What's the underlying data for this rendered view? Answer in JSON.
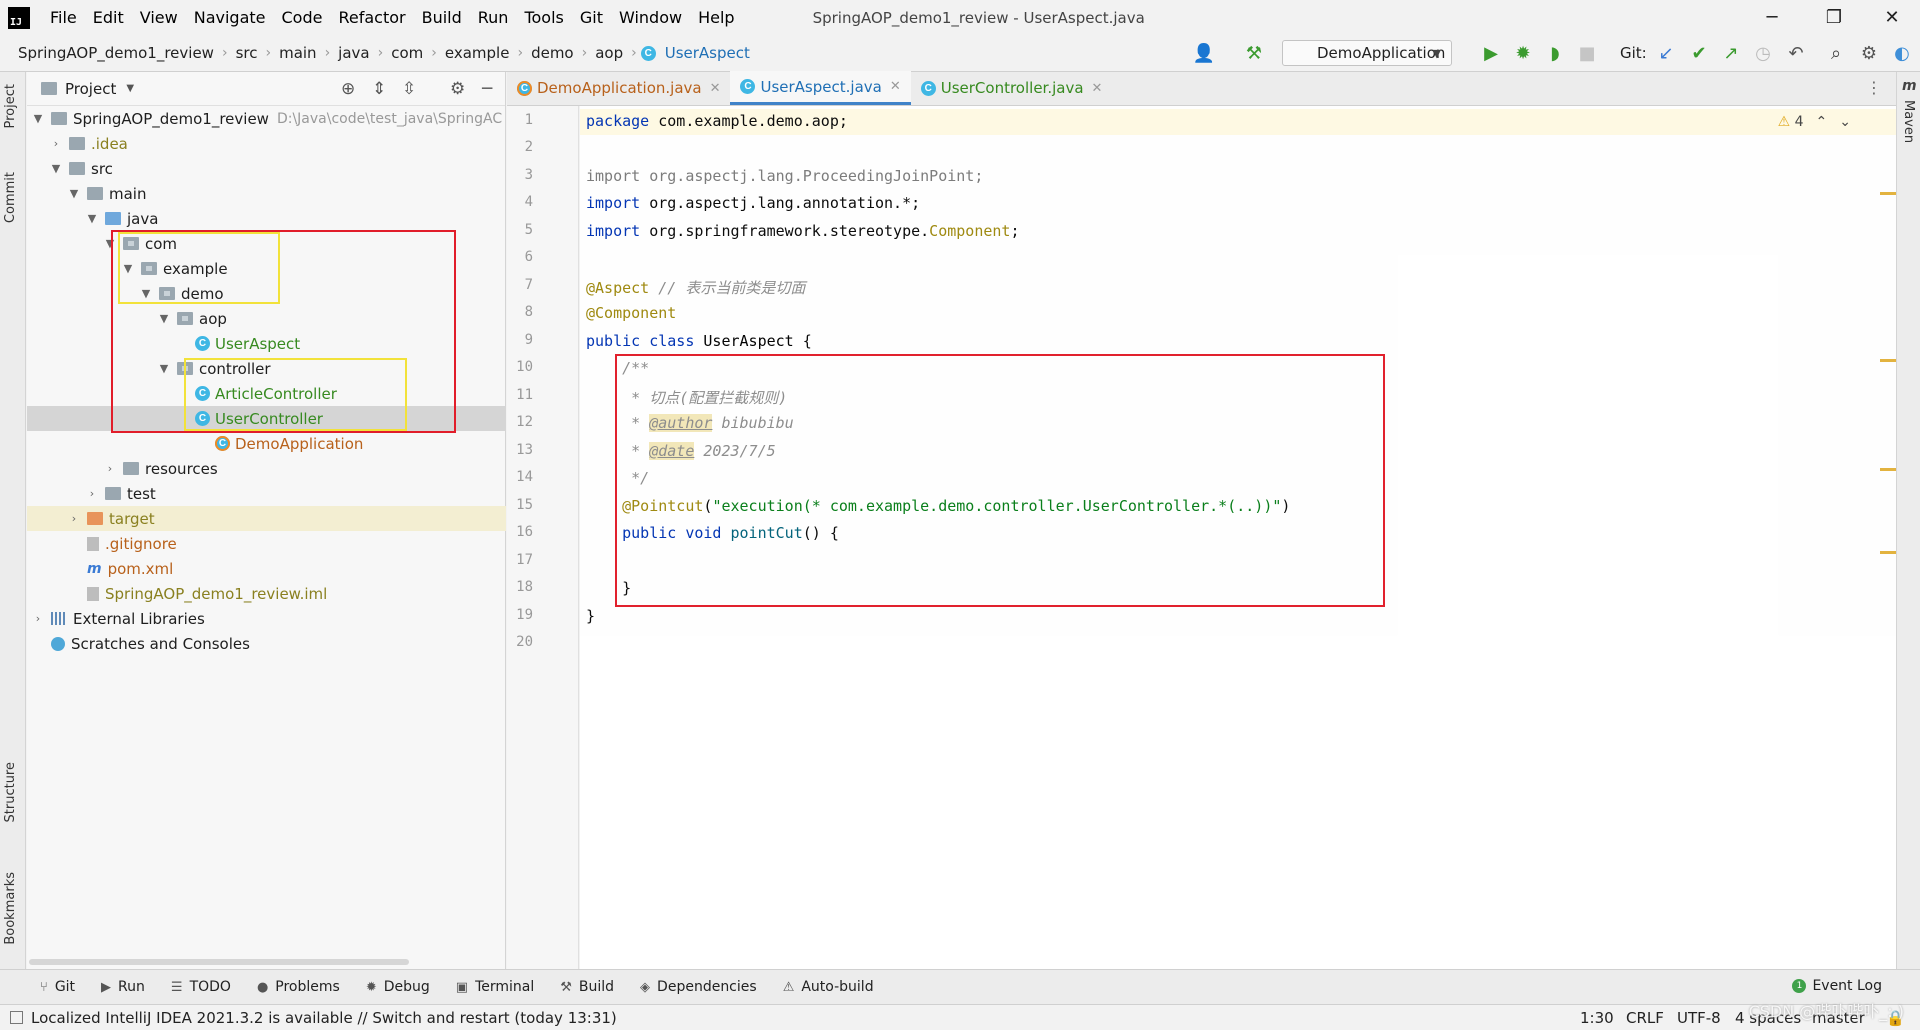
{
  "menu": {
    "items": [
      "File",
      "Edit",
      "View",
      "Navigate",
      "Code",
      "Refactor",
      "Build",
      "Run",
      "Tools",
      "Git",
      "Window",
      "Help"
    ],
    "window_title": "SpringAOP_demo1_review - UserAspect.java",
    "logo_text": "IJ"
  },
  "breadcrumb": [
    "SpringAOP_demo1_review",
    "src",
    "main",
    "java",
    "com",
    "example",
    "demo",
    "aop",
    "UserAspect"
  ],
  "toolbar": {
    "run_config": "DemoApplication",
    "git_label": "Git:"
  },
  "stripes": {
    "project": "Project",
    "commit": "Commit",
    "structure": "Structure",
    "bookmarks": "Bookmarks",
    "maven": "Maven",
    "maven_icon": "m"
  },
  "project_panel": {
    "title": "Project",
    "root_name": "SpringAOP_demo1_review",
    "root_path": "D:\\Java\\code\\test_java\\SpringAC",
    "nodes": {
      "idea": ".idea",
      "src": "src",
      "main": "main",
      "java": "java",
      "com": "com",
      "example": "example",
      "demo": "demo",
      "aop": "aop",
      "user_aspect": "UserAspect",
      "controller": "controller",
      "article_controller": "ArticleController",
      "user_controller": "UserController",
      "demo_application": "DemoApplication",
      "resources": "resources",
      "test": "test",
      "target": "target",
      "gitignore": ".gitignore",
      "pom": "pom.xml",
      "iml": "SpringAOP_demo1_review.iml",
      "external_libraries": "External Libraries",
      "scratches": "Scratches and Consoles"
    }
  },
  "tabs": [
    {
      "label": "DemoApplication.java",
      "active": false
    },
    {
      "label": "UserAspect.java",
      "active": true
    },
    {
      "label": "UserController.java",
      "active": false
    }
  ],
  "editor": {
    "warning_count": "4",
    "line_numbers": [
      "1",
      "2",
      "3",
      "4",
      "5",
      "6",
      "7",
      "8",
      "9",
      "10",
      "11",
      "12",
      "13",
      "14",
      "15",
      "16",
      "17",
      "18",
      "19",
      "20"
    ],
    "lines": {
      "l1_kw": "package",
      "l1_rest": " com.example.demo.aop;",
      "l3": "import org.aspectj.lang.ProceedingJoinPoint;",
      "l4_kw": "import",
      "l4_rest": " org.aspectj.lang.annotation.*;",
      "l5_kw": "import",
      "l5_rest": " org.springframework.stereotype.",
      "l5_comp": "Component",
      "l5_end": ";",
      "l7_ann": "@Aspect",
      "l7_cmt": " // 表示当前类是切面",
      "l8_ann": "@Component",
      "l9_kw": "public class",
      "l9_name": " UserAspect ",
      "l9_brace": "{",
      "l10": "    /**",
      "l11": "     * 切点(配置拦截规则)",
      "l12_pre": "     * ",
      "l12_tag": "@author",
      "l12_val": " bibubibu",
      "l13_pre": "     * ",
      "l13_tag": "@date",
      "l13_val": " 2023/7/5",
      "l14": "     */",
      "l15_ann": "    @Pointcut",
      "l15_open": "(",
      "l15_str": "\"execution(* com.example.demo.controller.UserController.*(..))\"",
      "l15_close": ")",
      "l16_kw": "    public void",
      "l16_mth": " pointCut",
      "l16_rest": "() {",
      "l18": "    }",
      "l19": "}"
    }
  },
  "bottom_tools": [
    {
      "icon": "git-branch-icon",
      "glyph": "⑂",
      "label": "Git"
    },
    {
      "icon": "run-icon",
      "glyph": "▶",
      "label": "Run"
    },
    {
      "icon": "todo-icon",
      "glyph": "☰",
      "label": "TODO"
    },
    {
      "icon": "problems-icon",
      "glyph": "●",
      "label": "Problems"
    },
    {
      "icon": "debug-icon",
      "glyph": "✹",
      "label": "Debug"
    },
    {
      "icon": "terminal-icon",
      "glyph": "▣",
      "label": "Terminal"
    },
    {
      "icon": "build-icon",
      "glyph": "⚒",
      "label": "Build"
    },
    {
      "icon": "dependencies-icon",
      "glyph": "◈",
      "label": "Dependencies"
    },
    {
      "icon": "warning-icon",
      "glyph": "⚠",
      "label": "Auto-build"
    }
  ],
  "event_log": {
    "label": "Event Log",
    "count": "1"
  },
  "statusbar": {
    "message": "Localized IntelliJ IDEA 2021.3.2 is available // Switch and restart (today 13:31)",
    "position": "1:30",
    "line_sep": "CRLF",
    "encoding": "UTF-8",
    "indent": "4 spaces",
    "branch": "master"
  },
  "watermark": "CSDN @哔卟哔卟_: )",
  "colors": {
    "highlight_red": "#e11d2a",
    "highlight_yellow": "#f2e23a",
    "keyword": "#0033b3",
    "annotation": "#9e880d",
    "string": "#067d17"
  }
}
